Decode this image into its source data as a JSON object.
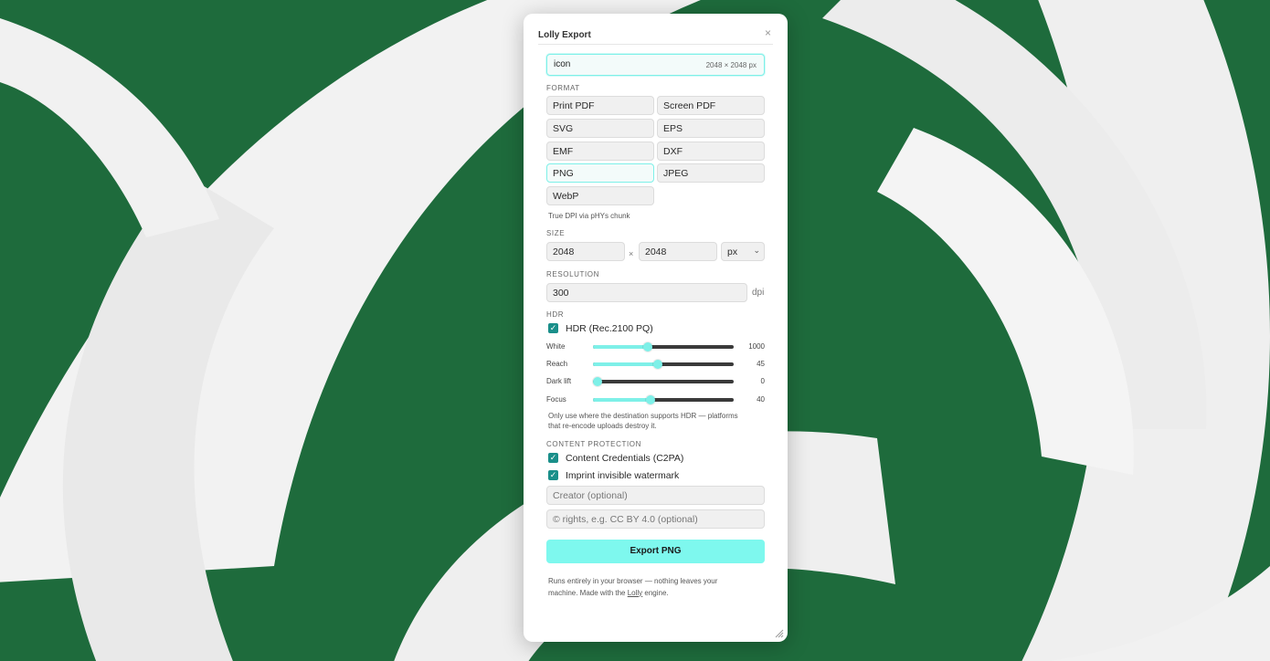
{
  "panel": {
    "title": "Lolly Export",
    "close_glyph": "×"
  },
  "name_field": {
    "value": "icon",
    "dims": "2048 × 2048 px"
  },
  "format": {
    "label": "FORMAT",
    "options": [
      "Print PDF",
      "Screen PDF",
      "SVG",
      "EPS",
      "EMF",
      "DXF",
      "PNG",
      "JPEG",
      "WebP"
    ],
    "selected": "PNG",
    "note": "True DPI via pHYs chunk"
  },
  "size": {
    "label": "SIZE",
    "width": "2048",
    "times": "×",
    "height": "2048",
    "unit": "px"
  },
  "resolution": {
    "label": "RESOLUTION",
    "value": "300",
    "unit": "dpi"
  },
  "hdr": {
    "label": "HDR",
    "checkbox_label": "HDR (Rec.2100 PQ)",
    "sliders": [
      {
        "label": "White",
        "value": "1000",
        "level": 0.39
      },
      {
        "label": "Reach",
        "value": "45",
        "level": 0.46
      },
      {
        "label": "Dark lift",
        "value": "0",
        "level": 0.0
      },
      {
        "label": "Focus",
        "value": "40",
        "level": 0.41
      }
    ],
    "note_line1": "Only use where the destination supports HDR — platforms",
    "note_line2": "that re-encode uploads destroy it."
  },
  "content_protection": {
    "label": "CONTENT PROTECTION",
    "credentials_label": "Content Credentials (C2PA)",
    "watermark_label": "Imprint invisible watermark",
    "creator_placeholder": "Creator (optional)",
    "rights_placeholder": "© rights, e.g. CC BY 4.0 (optional)"
  },
  "export_button": "Export PNG",
  "footer": {
    "line1": "Runs entirely in your browser — nothing leaves your",
    "line2_prefix": "machine. Made with the ",
    "link": "Lolly",
    "line2_suffix": " engine."
  },
  "colors": {
    "accent": "#7ef0e8",
    "checkbox": "#1a8f8a",
    "background_green": "#1e6b3c",
    "background_white": "#f2f2f2"
  }
}
